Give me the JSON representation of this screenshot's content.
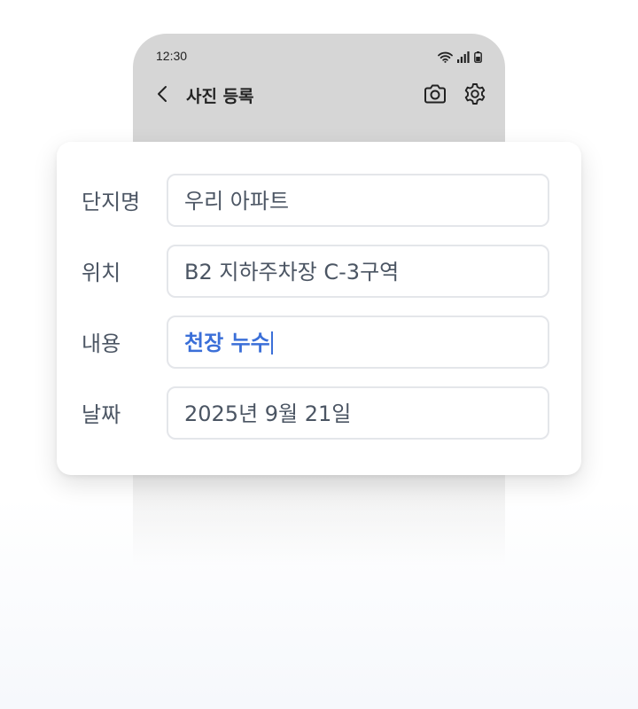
{
  "status_bar": {
    "time": "12:30"
  },
  "app_bar": {
    "title": "사진 등록"
  },
  "form": {
    "rows": [
      {
        "label": "단지명",
        "value": "우리 아파트"
      },
      {
        "label": "위치",
        "value": "B2 지하주차장 C-3구역"
      },
      {
        "label": "내용",
        "value": "천장 누수"
      },
      {
        "label": "날짜",
        "value": "2025년 9월 21일"
      }
    ]
  },
  "icons": {
    "back": "chevron-left-icon",
    "camera": "camera-icon",
    "settings": "gear-icon",
    "wifi": "wifi-icon",
    "signal": "signal-icon",
    "battery": "battery-icon"
  },
  "colors": {
    "accent": "#3b6fd8",
    "phone_bg": "#d6d6d6",
    "label_text": "#4b5563",
    "field_border": "#e4e6ea"
  }
}
